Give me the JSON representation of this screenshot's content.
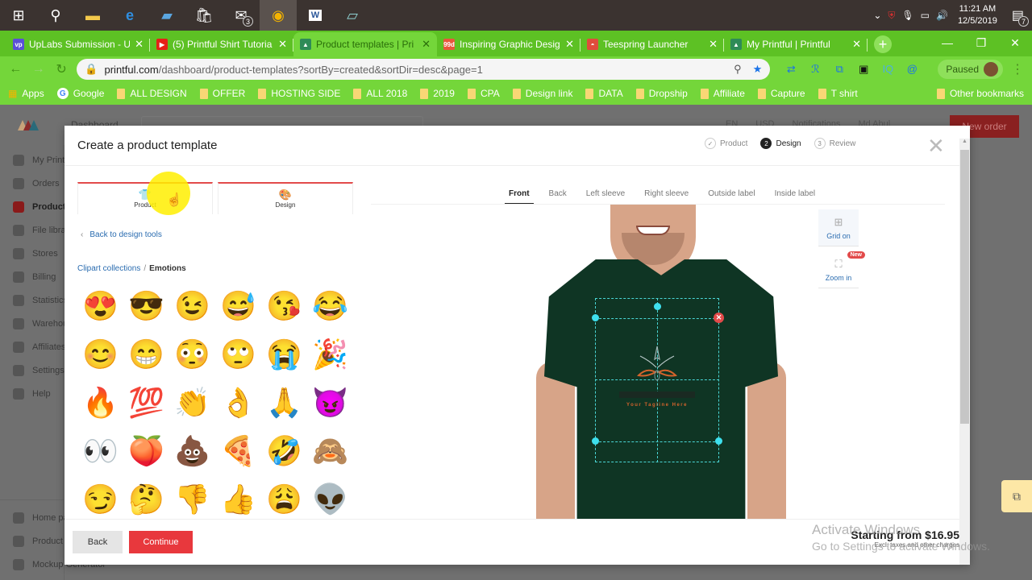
{
  "taskbar": {
    "icons": [
      "windows-start",
      "search",
      "file-explorer",
      "edge",
      "app-blue",
      "store",
      "mail",
      "chrome",
      "word",
      "notepad"
    ],
    "mail_badge": "3",
    "time": "11:21 AM",
    "date": "12/5/2019",
    "notification_count": "7"
  },
  "browser": {
    "tabs": [
      {
        "title": "UpLabs Submission - U",
        "favicon": "vp",
        "color": "#5b4fd6",
        "active": false
      },
      {
        "title": "(5) Printful Shirt Tutoria",
        "favicon": "▶",
        "color": "#e62117",
        "active": false
      },
      {
        "title": "Product templates | Pri",
        "favicon": "▲",
        "color": "#2e8b57",
        "active": true
      },
      {
        "title": "Inspiring Graphic Desig",
        "favicon": "99d",
        "color": "#e8573c",
        "active": false
      },
      {
        "title": "Teespring Launcher",
        "favicon": "◓",
        "color": "#e04c3c",
        "active": false
      },
      {
        "title": "My Printful | Printful",
        "favicon": "▲",
        "color": "#2e8b57",
        "active": false
      }
    ],
    "url_host": "printful.com",
    "url_path": "/dashboard/product-templates?sortBy=created&sortDir=desc&page=1",
    "profile_label": "Paused",
    "bookmarks": [
      {
        "label": "Apps",
        "type": "apps"
      },
      {
        "label": "Google",
        "type": "google"
      },
      {
        "label": "ALL DESIGN",
        "type": "folder"
      },
      {
        "label": "OFFER",
        "type": "folder"
      },
      {
        "label": "HOSTING  SIDE",
        "type": "folder"
      },
      {
        "label": "ALL 2018",
        "type": "folder"
      },
      {
        "label": "2019",
        "type": "folder"
      },
      {
        "label": "CPA",
        "type": "folder"
      },
      {
        "label": "Design link",
        "type": "folder"
      },
      {
        "label": "DATA",
        "type": "folder"
      },
      {
        "label": "Dropship",
        "type": "folder"
      },
      {
        "label": "Affiliate",
        "type": "folder"
      },
      {
        "label": "Capture",
        "type": "folder"
      },
      {
        "label": "T shirt",
        "type": "folder"
      }
    ],
    "other_bookmarks": "Other bookmarks"
  },
  "background_page": {
    "header_label": "Dashboard",
    "top_links": [
      "EN",
      "USD",
      "Notifications",
      "Md Abul"
    ],
    "new_order": "New order",
    "sidebar": [
      {
        "label": "My Printful",
        "active": false
      },
      {
        "label": "Orders",
        "active": false
      },
      {
        "label": "Product templates",
        "active": true
      },
      {
        "label": "File library",
        "active": false
      },
      {
        "label": "Stores",
        "active": false
      },
      {
        "label": "Billing",
        "active": false
      },
      {
        "label": "Statistics",
        "active": false
      },
      {
        "label": "Warehousing",
        "active": false
      },
      {
        "label": "Affiliates",
        "active": false
      },
      {
        "label": "Settings",
        "active": false
      },
      {
        "label": "Help",
        "active": false
      }
    ],
    "sidebar_bottom": [
      {
        "label": "Home page"
      },
      {
        "label": "Product catalog"
      },
      {
        "label": "Mockup Generator"
      }
    ]
  },
  "modal": {
    "title": "Create a product template",
    "steps": [
      {
        "num": "✓",
        "label": "Product",
        "state": "done"
      },
      {
        "num": "2",
        "label": "Design",
        "state": "current"
      },
      {
        "num": "3",
        "label": "Review",
        "state": "todo"
      }
    ],
    "tool_buttons": [
      {
        "label": "Product",
        "icon": "tshirt-icon"
      },
      {
        "label": "Design",
        "icon": "palette-icon"
      }
    ],
    "back_link": "Back to design tools",
    "breadcrumb": {
      "parent": "Clipart collections",
      "separator": "/",
      "current": "Emotions"
    },
    "emojis": [
      {
        "name": "heart-eyes",
        "glyph": "😍"
      },
      {
        "name": "sunglasses",
        "glyph": "😎"
      },
      {
        "name": "wink",
        "glyph": "😉"
      },
      {
        "name": "sweat-smile",
        "glyph": "😅"
      },
      {
        "name": "kiss-heart",
        "glyph": "😘"
      },
      {
        "name": "tears-of-joy",
        "glyph": "😂"
      },
      {
        "name": "blush",
        "glyph": "😊"
      },
      {
        "name": "grin",
        "glyph": "😁"
      },
      {
        "name": "flushed",
        "glyph": "😳"
      },
      {
        "name": "eye-roll",
        "glyph": "🙄"
      },
      {
        "name": "sob",
        "glyph": "😭"
      },
      {
        "name": "party-popper",
        "glyph": "🎉"
      },
      {
        "name": "fire",
        "glyph": "🔥"
      },
      {
        "name": "hundred",
        "glyph": "💯"
      },
      {
        "name": "clap",
        "glyph": "👏"
      },
      {
        "name": "ok-hand",
        "glyph": "👌"
      },
      {
        "name": "pray",
        "glyph": "🙏"
      },
      {
        "name": "devil",
        "glyph": "😈"
      },
      {
        "name": "eyes",
        "glyph": "👀"
      },
      {
        "name": "peach",
        "glyph": "🍑"
      },
      {
        "name": "poop",
        "glyph": "💩"
      },
      {
        "name": "pizza",
        "glyph": "🍕"
      },
      {
        "name": "rofl",
        "glyph": "🤣"
      },
      {
        "name": "see-no-evil",
        "glyph": "🙈"
      },
      {
        "name": "smirk",
        "glyph": "😏"
      },
      {
        "name": "thinking",
        "glyph": "🤔"
      },
      {
        "name": "thumbs-down",
        "glyph": "👎"
      },
      {
        "name": "thumbs-up",
        "glyph": "👍"
      },
      {
        "name": "weary",
        "glyph": "😩"
      },
      {
        "name": "alien",
        "glyph": "👽"
      }
    ],
    "view_tabs": [
      {
        "label": "Front",
        "active": true
      },
      {
        "label": "Back",
        "active": false
      },
      {
        "label": "Left sleeve",
        "active": false
      },
      {
        "label": "Right sleeve",
        "active": false
      },
      {
        "label": "Outside label",
        "active": false
      },
      {
        "label": "Inside label",
        "active": false
      }
    ],
    "grid_tool": "Grid on",
    "zoom_tool": "Zoom in",
    "new_badge": "New",
    "design_tagline": "Your Tagline Here",
    "shirt_color": "#0f3524",
    "back_button": "Back",
    "continue_button": "Continue",
    "price": "Starting from $16.95",
    "price_note": "Excl. taxes and other charges"
  },
  "watermark": {
    "line1": "Activate Windows",
    "line2": "Go to Settings to activate Windows."
  },
  "colors": {
    "accent_red": "#e8383d",
    "link_blue": "#2a6cb0",
    "chrome_green": "#5dc124",
    "print_guide": "#4ad6d6"
  }
}
